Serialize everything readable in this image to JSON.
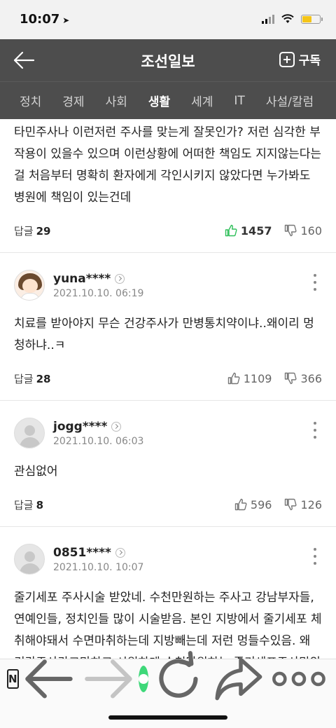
{
  "status": {
    "time": "10:07"
  },
  "header": {
    "title": "조선일보",
    "subscribe_label": "구독"
  },
  "tabs": [
    {
      "label": "정치"
    },
    {
      "label": "경제"
    },
    {
      "label": "사회"
    },
    {
      "label": "생활",
      "active": true
    },
    {
      "label": "세계"
    },
    {
      "label": "IT"
    },
    {
      "label": "사설/칼럼"
    }
  ],
  "comments": [
    {
      "text": "타민주사나 이런저런 주사를 맞는게 잘못인가? 저런 심각한 부작용이 있을수 있으며 이런상황에 어떠한 책임도 지지않는다는 걸 처음부터 명확히 환자에게 각인시키지 않았다면 누가봐도 병원에 책임이 있는건데",
      "reply_label": "답글",
      "reply_count": "29",
      "likes": "1457",
      "dislikes": "160"
    },
    {
      "user": "yuna****",
      "date": "2021.10.10. 06:19",
      "text": "치료를 받아야지 무슨 건강주사가 만병통치약이냐..왜이리 멍청하냐..ㅋ",
      "reply_label": "답글",
      "reply_count": "28",
      "likes": "1109",
      "dislikes": "366"
    },
    {
      "user": "jogg****",
      "date": "2021.10.10. 06:03",
      "text": "관심없어",
      "reply_label": "답글",
      "reply_count": "8",
      "likes": "596",
      "dislikes": "126"
    },
    {
      "user": "0851****",
      "date": "2021.10.10. 10:07",
      "text": "줄기세포 주사시술 받았네. 수천만원하는 주사고 강남부자들, 연예인들, 정치인들 많이 시술받음. 본인 지방에서 줄기세포 체취해야돼서 수면마취하는데 지방빼는데 저런 멍들수있음. 왜 건강주사라고만하고 시원하게 수천만원하는 줄기세포주사맞았다고는 안밝히냐"
    }
  ],
  "bottom_nav": {
    "n_label": "N"
  },
  "colors": {
    "header_bg": "#4d4d4d",
    "accent_green": "#3ed879",
    "like_green": "#2fbf5a"
  }
}
